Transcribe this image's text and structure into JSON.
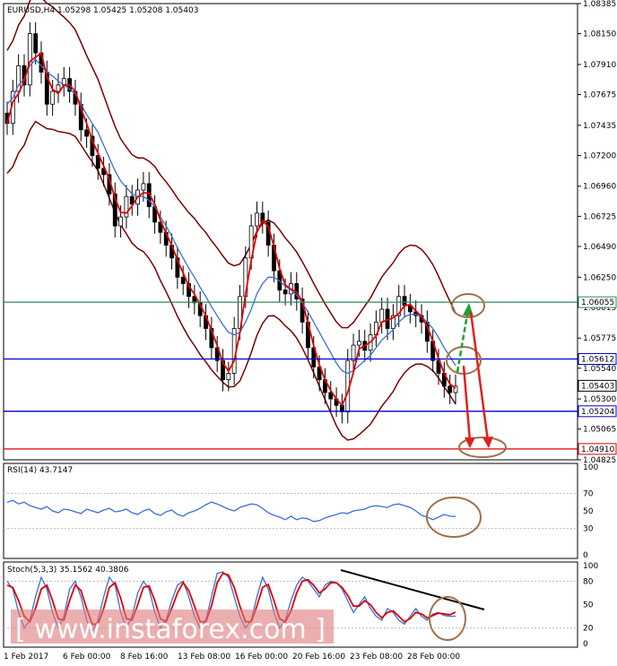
{
  "chart_data": {
    "type": "line",
    "header": "EURUSD,H4  1.05298 1.05425 1.05208 1.05403",
    "price_axis": {
      "min": 1.04825,
      "max": 1.08385,
      "ticks": [
        "1.08385",
        "1.08150",
        "1.07910",
        "1.07675",
        "1.07435",
        "1.07200",
        "1.06960",
        "1.06725",
        "1.06490",
        "1.06250",
        "1.06015",
        "1.05775",
        "1.05540",
        "1.05300",
        "1.05065",
        "1.04825"
      ]
    },
    "levels": [
      {
        "value": 1.06055,
        "label": "1.06055",
        "color": "#2e8b57"
      },
      {
        "value": 1.05612,
        "label": "1.05612",
        "color": "#0000cc"
      },
      {
        "value": 1.05403,
        "label": "1.05403",
        "color": "#000000"
      },
      {
        "value": 1.05204,
        "label": "1.05204",
        "color": "#0000cc"
      },
      {
        "value": 1.0491,
        "label": "1.04910",
        "color": "#dd0000"
      }
    ],
    "x_axis_labels": [
      "1 Feb 2017",
      "6 Feb 00:00",
      "8 Feb 16:00",
      "13 Feb 08:00",
      "16 Feb 00:00",
      "20 Feb 16:00",
      "23 Feb 08:00",
      "28 Feb 00:00"
    ],
    "price_series": {
      "close": [
        1.0745,
        1.077,
        1.079,
        1.0775,
        1.0815,
        1.08,
        1.0785,
        1.076,
        1.077,
        1.0775,
        1.078,
        1.077,
        1.076,
        1.074,
        1.0735,
        1.072,
        1.071,
        1.0705,
        1.069,
        1.0665,
        1.0672,
        1.0688,
        1.0682,
        1.0693,
        1.0698,
        1.068,
        1.0668,
        1.066,
        1.065,
        1.064,
        1.0625,
        1.062,
        1.061,
        1.0605,
        1.0595,
        1.0585,
        1.057,
        1.056,
        1.0545,
        1.055,
        1.0585,
        1.061,
        1.064,
        1.0665,
        1.0675,
        1.0668,
        1.065,
        1.063,
        1.0615,
        1.0612,
        1.062,
        1.0608,
        1.059,
        1.057,
        1.0555,
        1.0545,
        1.0535,
        1.053,
        1.0525,
        1.052,
        1.056,
        1.0572,
        1.0575,
        1.0568,
        1.058,
        1.059,
        1.06,
        1.0585,
        1.0595,
        1.061,
        1.0603,
        1.0598,
        1.0595,
        1.059,
        1.0575,
        1.056,
        1.055,
        1.054,
        1.0535,
        1.054
      ],
      "sma": [
        1.076,
        1.0765,
        1.0775,
        1.078,
        1.079,
        1.0795,
        1.079,
        1.0785,
        1.0782,
        1.0778,
        1.0775,
        1.0772,
        1.0768,
        1.076,
        1.0752,
        1.0745,
        1.0738,
        1.0728,
        1.0718,
        1.0708,
        1.07,
        1.0695,
        1.069,
        1.0688,
        1.0688,
        1.0685,
        1.068,
        1.0672,
        1.0665,
        1.0657,
        1.0648,
        1.064,
        1.0632,
        1.0625,
        1.0617,
        1.061,
        1.0602,
        1.0595,
        1.0588,
        1.0582,
        1.058,
        1.0582,
        1.059,
        1.06,
        1.0612,
        1.062,
        1.0625,
        1.0625,
        1.0622,
        1.0618,
        1.0615,
        1.0611,
        1.0605,
        1.0598,
        1.059,
        1.0582,
        1.0574,
        1.0566,
        1.0558,
        1.0552,
        1.055,
        1.0552,
        1.0556,
        1.056,
        1.0564,
        1.057,
        1.0576,
        1.058,
        1.0584,
        1.059,
        1.0594,
        1.0596,
        1.0596,
        1.0594,
        1.059,
        1.0585,
        1.0578,
        1.057,
        1.0563,
        1.0556
      ]
    },
    "rsi": {
      "label": "RSI(14) 43.7147",
      "ticks": [
        "100",
        "70",
        "50",
        "30",
        "0"
      ],
      "values": [
        60,
        62,
        58,
        60,
        56,
        54,
        52,
        55,
        50,
        48,
        52,
        51,
        49,
        47,
        52,
        50,
        48,
        51,
        53,
        49,
        50,
        52,
        48,
        46,
        50,
        52,
        47,
        45,
        49,
        51,
        46,
        44,
        48,
        50,
        53,
        57,
        60,
        58,
        55,
        52,
        50,
        54,
        56,
        58,
        57,
        53,
        48,
        45,
        43,
        40,
        44,
        40,
        42,
        41,
        38,
        39,
        42,
        44,
        46,
        48,
        47,
        50,
        51,
        52,
        55,
        56,
        55,
        54,
        57,
        58,
        56,
        54,
        50,
        45,
        43,
        40,
        43,
        46,
        44,
        43.7
      ]
    },
    "stoch": {
      "label": "Stoch(5,3,3) 35.1562 40.3806",
      "ticks": [
        "100",
        "80",
        "50",
        "20",
        "0"
      ],
      "main": [
        80,
        70,
        40,
        20,
        30,
        60,
        85,
        70,
        40,
        20,
        35,
        70,
        80,
        60,
        30,
        15,
        30,
        60,
        85,
        75,
        40,
        20,
        35,
        65,
        80,
        70,
        40,
        20,
        30,
        55,
        75,
        80,
        60,
        35,
        20,
        30,
        60,
        90,
        92,
        85,
        60,
        35,
        20,
        30,
        60,
        85,
        70,
        40,
        20,
        30,
        55,
        75,
        85,
        80,
        70,
        60,
        75,
        80,
        78,
        70,
        55,
        40,
        50,
        60,
        45,
        35,
        30,
        45,
        40,
        30,
        25,
        35,
        45,
        35,
        30,
        38,
        40,
        36,
        35,
        35.2
      ],
      "signal": [
        75,
        72,
        55,
        35,
        28,
        45,
        70,
        75,
        55,
        32,
        30,
        55,
        75,
        68,
        45,
        25,
        25,
        45,
        72,
        78,
        58,
        32,
        30,
        50,
        72,
        74,
        55,
        32,
        28,
        45,
        65,
        78,
        68,
        48,
        28,
        28,
        48,
        78,
        90,
        88,
        72,
        48,
        28,
        28,
        48,
        72,
        76,
        55,
        32,
        28,
        42,
        65,
        80,
        82,
        75,
        65,
        70,
        78,
        78,
        72,
        62,
        48,
        48,
        55,
        50,
        40,
        33,
        40,
        42,
        35,
        28,
        32,
        40,
        38,
        33,
        36,
        39,
        38,
        37,
        40.4
      ]
    }
  },
  "watermark": "[ www.instaforex.com ]"
}
